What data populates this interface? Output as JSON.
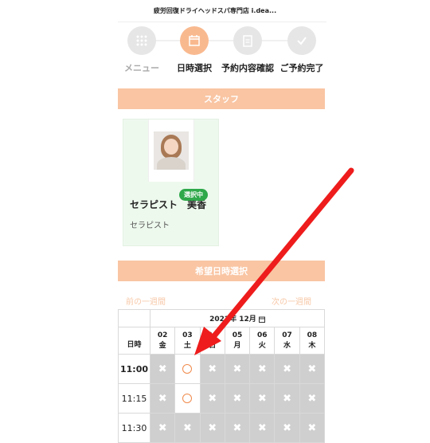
{
  "store": {
    "title": "疲労回復ドライヘッドスパ専門店 i.dea..."
  },
  "steps": [
    {
      "label": "メニュー",
      "icon": "grid-icon"
    },
    {
      "label": "日時選択",
      "icon": "calendar-icon"
    },
    {
      "label": "予約内容確認",
      "icon": "clipboard-icon"
    },
    {
      "label": "ご予約完了",
      "icon": "check-icon"
    }
  ],
  "staff_section": {
    "title": "スタッフ"
  },
  "staff": {
    "badge": "選択中",
    "name": "セラピスト　美香",
    "role": "セラピスト"
  },
  "datetime_section": {
    "title": "希望日時選択"
  },
  "nav": {
    "prev": "前の一週間",
    "next": "次の一週間"
  },
  "calendar": {
    "month": "2022年 12月",
    "time_header": "日時",
    "days": [
      {
        "day": "02",
        "dow": "金"
      },
      {
        "day": "03",
        "dow": "土"
      },
      {
        "day": "04",
        "dow": "日"
      },
      {
        "day": "05",
        "dow": "月"
      },
      {
        "day": "06",
        "dow": "火"
      },
      {
        "day": "07",
        "dow": "水"
      },
      {
        "day": "08",
        "dow": "木"
      }
    ],
    "slots": [
      {
        "time": "11:00",
        "cells": [
          "✖",
          "○",
          "✖",
          "✖",
          "✖",
          "✖",
          "✖"
        ]
      },
      {
        "time": "11:15",
        "cells": [
          "✖",
          "○",
          "✖",
          "✖",
          "✖",
          "✖",
          "✖"
        ]
      },
      {
        "time": "11:30",
        "cells": [
          "✖",
          "✖",
          "✖",
          "✖",
          "✖",
          "✖",
          "✖"
        ]
      }
    ]
  },
  "colors": {
    "accent": "#f9c5a3",
    "arrow": "#ee1c1c",
    "selected_badge": "#2fa84a"
  }
}
